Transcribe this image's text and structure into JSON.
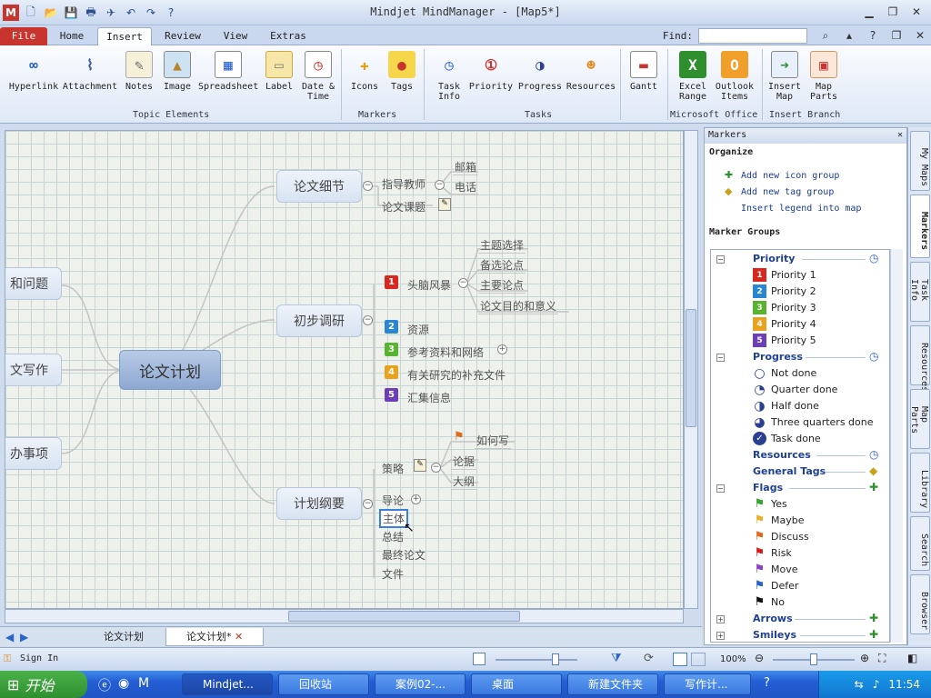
{
  "app": {
    "title": "Mindjet MindManager - [Map5*]"
  },
  "ribbon_tabs": [
    "File",
    "Home",
    "Insert",
    "Review",
    "View",
    "Extras"
  ],
  "find": {
    "label": "Find:"
  },
  "ribbon": {
    "topic_elements": [
      {
        "label": "Hyperlink",
        "icon": "hyperlink-icon"
      },
      {
        "label": "Attachment",
        "icon": "paperclip-icon"
      },
      {
        "label": "Notes",
        "icon": "notes-icon"
      },
      {
        "label": "Image",
        "icon": "image-icon"
      },
      {
        "label": "Spreadsheet",
        "icon": "spreadsheet-icon"
      },
      {
        "label": "Label",
        "icon": "label-icon"
      },
      {
        "label": "Date &",
        "label2": "Time",
        "icon": "calendar-icon"
      }
    ],
    "markers": [
      {
        "label": "Icons",
        "icon": "pin-icon"
      },
      {
        "label": "Tags",
        "icon": "tag-icon"
      }
    ],
    "tasks": [
      {
        "label": "Task",
        "label2": "Info",
        "icon": "clock-check-icon"
      },
      {
        "label": "Priority",
        "icon": "priority-icon"
      },
      {
        "label": "Progress",
        "icon": "progress-icon"
      },
      {
        "label": "Resources",
        "icon": "person-icon"
      }
    ],
    "gantt": {
      "label": "Gantt",
      "icon": "gantt-icon"
    },
    "office": [
      {
        "label": "Excel",
        "label2": "Range",
        "icon": "excel-icon"
      },
      {
        "label": "Outlook",
        "label2": "Items",
        "icon": "outlook-icon"
      }
    ],
    "branch": [
      {
        "label": "Insert",
        "label2": "Map",
        "icon": "insert-map-icon"
      },
      {
        "label": "Map",
        "label2": "Parts",
        "icon": "map-parts-icon"
      }
    ],
    "groups": [
      "Topic Elements",
      "Markers",
      "Tasks",
      "Microsoft Office",
      "Insert Branch"
    ]
  },
  "map": {
    "central": "论文计划",
    "left_topics": [
      "和问题",
      "文写作",
      "办事项"
    ],
    "branch1": {
      "title": "论文细节",
      "sub1": "指导教师",
      "sub2": "论文课题",
      "leaves": [
        "邮箱",
        "电话"
      ]
    },
    "branch2": {
      "title": "初步调研",
      "items": [
        {
          "num": "1",
          "label": "头脑风暴",
          "color": "#d8271f"
        },
        {
          "num": "2",
          "label": "资源",
          "color": "#2a86d0"
        },
        {
          "num": "3",
          "label": "参考资料和网络",
          "color": "#58b32f"
        },
        {
          "num": "4",
          "label": "有关研究的补充文件",
          "color": "#e8a21c"
        },
        {
          "num": "5",
          "label": "汇集信息",
          "color": "#6c3fb9"
        }
      ],
      "leaves": [
        "主题选择",
        "备选论点",
        "主要论点",
        "论文目的和意义"
      ]
    },
    "branch3": {
      "title": "计划纲要",
      "items": [
        "策略",
        "导论",
        "主体",
        "总结",
        "最终论文",
        "文件"
      ],
      "leaves": [
        "如何写",
        "论据",
        "大纲"
      ]
    }
  },
  "doc_tabs": [
    "论文计划",
    "论文计划*"
  ],
  "panel": {
    "title": "Markers",
    "organize": "Organize",
    "links": [
      "Add new icon group",
      "Add new tag group",
      "Insert legend into map"
    ],
    "marker_groups_title": "Marker Groups",
    "groups": [
      {
        "name": "Priority",
        "items": [
          "Priority 1",
          "Priority 2",
          "Priority 3",
          "Priority 4",
          "Priority 5"
        ]
      },
      {
        "name": "Progress",
        "items": [
          "Not done",
          "Quarter done",
          "Half done",
          "Three quarters done",
          "Task done"
        ]
      },
      {
        "name": "Resources",
        "items": []
      },
      {
        "name": "General Tags",
        "items": []
      },
      {
        "name": "Flags",
        "items": [
          "Yes",
          "Maybe",
          "Discuss",
          "Risk",
          "Move",
          "Defer",
          "No"
        ]
      },
      {
        "name": "Arrows",
        "items": []
      },
      {
        "name": "Smileys",
        "items": []
      }
    ],
    "flag_colors": [
      "#2fa52a",
      "#e8b02a",
      "#e06a1a",
      "#d81a1a",
      "#8a3fc9",
      "#2a63c9",
      "#111111"
    ]
  },
  "side_tabs": [
    "My Maps",
    "Markers",
    "Task Info",
    "Resources",
    "Map Parts",
    "Library",
    "Search",
    "Browser"
  ],
  "status": {
    "signin": "Sign In",
    "zoom": "100%"
  },
  "taskbar": {
    "start": "开始",
    "items": [
      "Mindjet...",
      "回收站",
      "案例02-...",
      "桌面",
      "新建文件夹",
      "写作计..."
    ],
    "clock": "11:54"
  }
}
